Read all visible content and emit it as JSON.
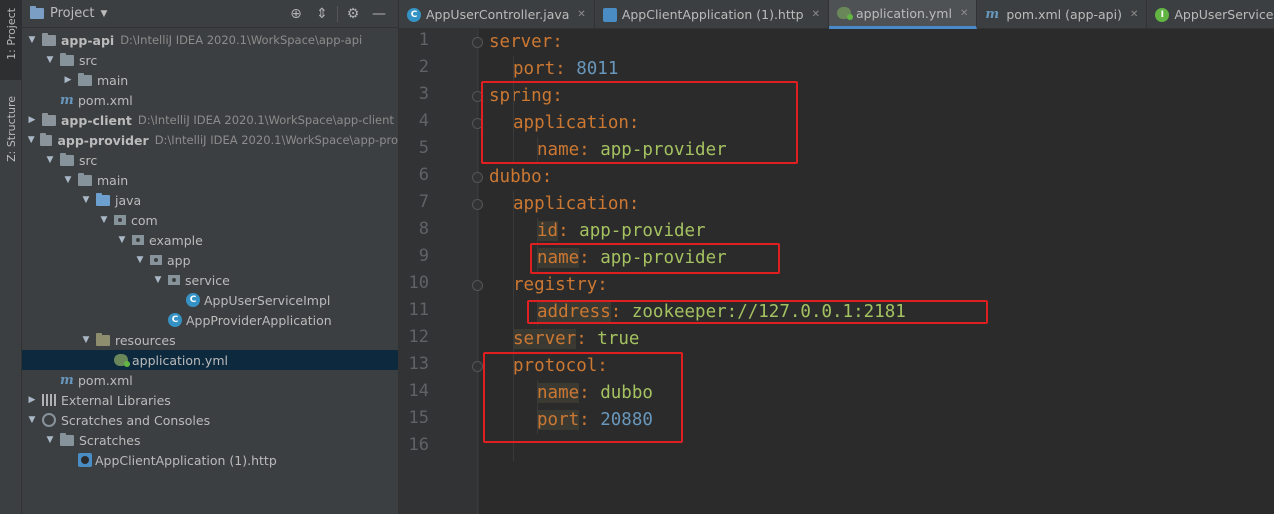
{
  "toolstrip": {
    "project_tab": "1: Project",
    "structure_tab": "Z: Structure"
  },
  "project_panel": {
    "title": "Project",
    "tree": [
      {
        "label": "app-api",
        "path": "D:\\IntelliJ IDEA 2020.1\\WorkSpace\\app-api",
        "bold": true
      },
      {
        "label": "src"
      },
      {
        "label": "main"
      },
      {
        "label": "pom.xml"
      },
      {
        "label": "app-client",
        "path": "D:\\IntelliJ IDEA 2020.1\\WorkSpace\\app-client",
        "bold": true
      },
      {
        "label": "app-provider",
        "path": "D:\\IntelliJ IDEA 2020.1\\WorkSpace\\app-pro",
        "bold": true
      },
      {
        "label": "src"
      },
      {
        "label": "main"
      },
      {
        "label": "java"
      },
      {
        "label": "com"
      },
      {
        "label": "example"
      },
      {
        "label": "app"
      },
      {
        "label": "service"
      },
      {
        "label": "AppUserServiceImpl"
      },
      {
        "label": "AppProviderApplication"
      },
      {
        "label": "resources"
      },
      {
        "label": "application.yml"
      },
      {
        "label": "pom.xml"
      },
      {
        "label": "External Libraries"
      },
      {
        "label": "Scratches and Consoles"
      },
      {
        "label": "Scratches"
      },
      {
        "label": "AppClientApplication (1).http"
      }
    ]
  },
  "tabs": [
    {
      "label": "AppUserController.java"
    },
    {
      "label": "AppClientApplication (1).http"
    },
    {
      "label": "application.yml",
      "active": true
    },
    {
      "label": "pom.xml (app-api)"
    },
    {
      "label": "AppUserService.java"
    }
  ],
  "editor": {
    "line_numbers": [
      "1",
      "2",
      "3",
      "4",
      "5",
      "6",
      "7",
      "8",
      "9",
      "10",
      "11",
      "12",
      "13",
      "14",
      "15",
      "16"
    ],
    "lines": [
      {
        "key": "server",
        "sep": ":",
        "value": ""
      },
      {
        "key": "port",
        "sep": ": ",
        "value": "8011"
      },
      {
        "key": "spring",
        "sep": ":",
        "value": ""
      },
      {
        "key": "application",
        "sep": ":",
        "value": ""
      },
      {
        "key": "name",
        "sep": ": ",
        "value": "app-provider"
      },
      {
        "key": "dubbo",
        "sep": ":",
        "value": ""
      },
      {
        "key": "application",
        "sep": ":",
        "value": ""
      },
      {
        "key": "id",
        "sep": ": ",
        "value": "app-provider"
      },
      {
        "key": "name",
        "sep": ": ",
        "value": "app-provider"
      },
      {
        "key": "registry",
        "sep": ":",
        "value": ""
      },
      {
        "key": "address",
        "sep": ": ",
        "value": "zookeeper://127.0.0.1:2181"
      },
      {
        "key": "server",
        "sep": ": ",
        "value": "true"
      },
      {
        "key": "protocol",
        "sep": ":",
        "value": ""
      },
      {
        "key": "name",
        "sep": ": ",
        "value": "dubbo"
      },
      {
        "key": "port",
        "sep": ": ",
        "value": "20880"
      },
      {
        "key": "",
        "sep": "",
        "value": ""
      }
    ]
  },
  "colors": {
    "annotation_box": "#e02020",
    "keyword": "#cc7832",
    "string": "#a5c261",
    "number": "#6897bb"
  }
}
